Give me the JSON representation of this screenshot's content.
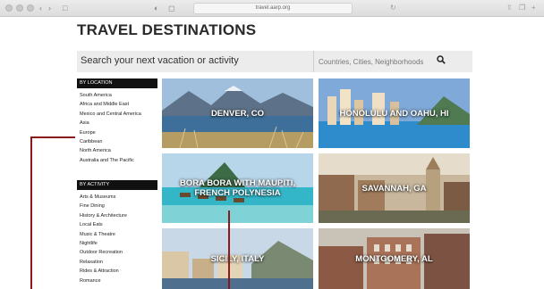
{
  "browser": {
    "url": "travel.aarp.org"
  },
  "page": {
    "title": "TRAVEL DESTINATIONS"
  },
  "search": {
    "label": "Search your next vacation or activity",
    "placeholder": "Countries, Cities, Neighborhoods"
  },
  "sidebar": {
    "location_header": "By Location",
    "locations": [
      "South America",
      "Africa and Middle East",
      "Mexico and Central America",
      "Asia",
      "Europe",
      "Caribbean",
      "North America",
      "Australia and The Pacific"
    ],
    "activity_header": "By Activity",
    "activities": [
      "Arts & Museums",
      "Fine Dining",
      "History & Architecture",
      "Local Eats",
      "Music & Theatre",
      "Nightlife",
      "Outdoor Recreation",
      "Relaxation",
      "Rides & Attraction",
      "Romance"
    ]
  },
  "destinations": [
    {
      "name": "DENVER, CO"
    },
    {
      "name": "HONOLULU AND OAHU, HI"
    },
    {
      "name": "BORA BORA WITH MAUPITI, FRENCH POLYNESIA"
    },
    {
      "name": "SAVANNAH, GA"
    },
    {
      "name": "SICILY, ITALY"
    },
    {
      "name": "MONTGOMERY, AL"
    }
  ],
  "colors": {
    "callout": "#8c1a1a",
    "header_bg": "#111111",
    "search_bg": "#ececec"
  }
}
